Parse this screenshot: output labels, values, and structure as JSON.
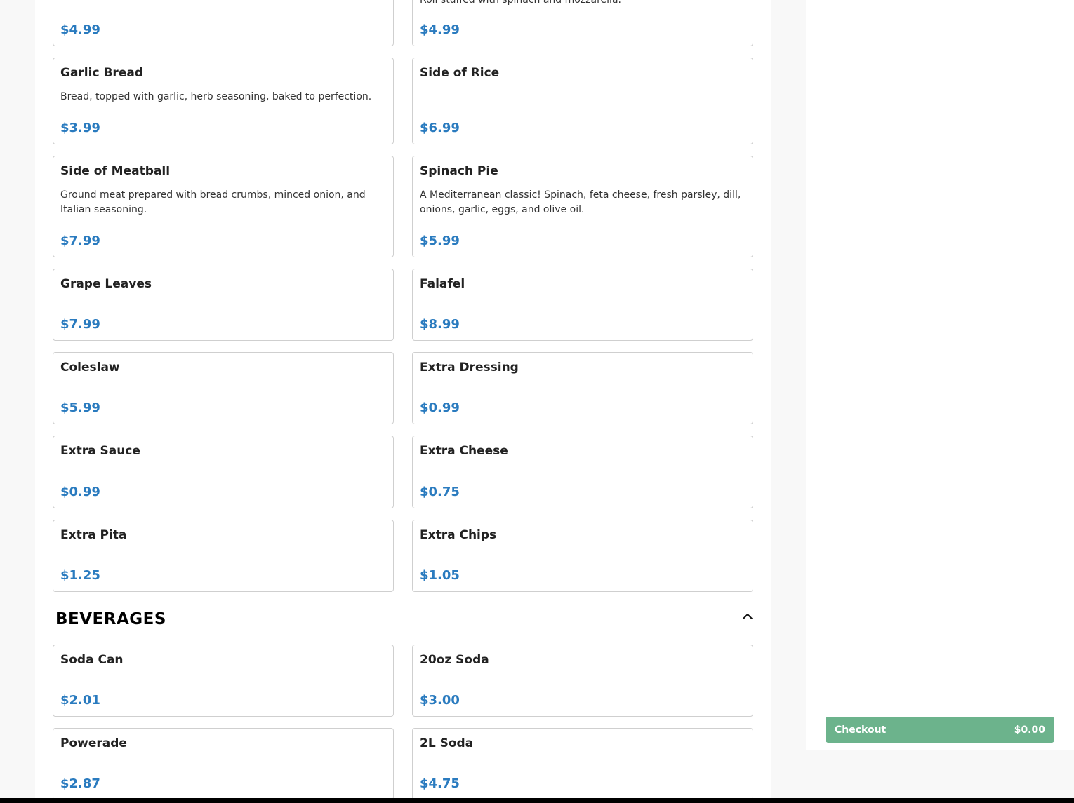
{
  "menu": {
    "items": [
      {
        "name": "",
        "description": "Roll stuffed with spinach and mozzarella.",
        "price": "$4.99"
      },
      {
        "name": "",
        "description": "",
        "price": "$4.99"
      },
      {
        "name": "Garlic Bread",
        "description": "Bread, topped with garlic, herb seasoning, baked to perfection.",
        "price": "$3.99"
      },
      {
        "name": "Side of Rice",
        "description": "",
        "price": "$6.99"
      },
      {
        "name": "Side of Meatball",
        "description": "Ground meat prepared with bread crumbs, minced onion, and Italian seasoning.",
        "price": "$7.99"
      },
      {
        "name": "Spinach Pie",
        "description": "A Mediterranean classic! Spinach, feta cheese, fresh parsley, dill, onions, garlic, eggs, and olive oil.",
        "price": "$5.99"
      },
      {
        "name": "Grape Leaves",
        "description": "",
        "price": "$7.99"
      },
      {
        "name": "Falafel",
        "description": "",
        "price": "$8.99"
      },
      {
        "name": "Coleslaw",
        "description": "",
        "price": "$5.99"
      },
      {
        "name": "Extra Dressing",
        "description": "",
        "price": "$0.99"
      },
      {
        "name": "Extra Sauce",
        "description": "",
        "price": "$0.99"
      },
      {
        "name": "Extra Cheese",
        "description": "",
        "price": "$0.75"
      },
      {
        "name": "Extra Pita",
        "description": "",
        "price": "$1.25"
      },
      {
        "name": "Extra Chips",
        "description": "",
        "price": "$1.05"
      }
    ],
    "beverages": {
      "title": "BEVERAGES",
      "toggle_icon": "chevron-up-icon",
      "items": [
        {
          "name": "Soda Can",
          "description": "",
          "price": "$2.01"
        },
        {
          "name": "20oz Soda",
          "description": "",
          "price": "$3.00"
        },
        {
          "name": "Powerade",
          "description": "",
          "price": "$2.87"
        },
        {
          "name": "2L Soda",
          "description": "",
          "price": "$4.75"
        }
      ]
    }
  },
  "cart": {
    "checkout_label": "Checkout",
    "total": "$0.00"
  },
  "colors": {
    "price": "#2a7bbf",
    "checkout": "#6cb38c"
  }
}
